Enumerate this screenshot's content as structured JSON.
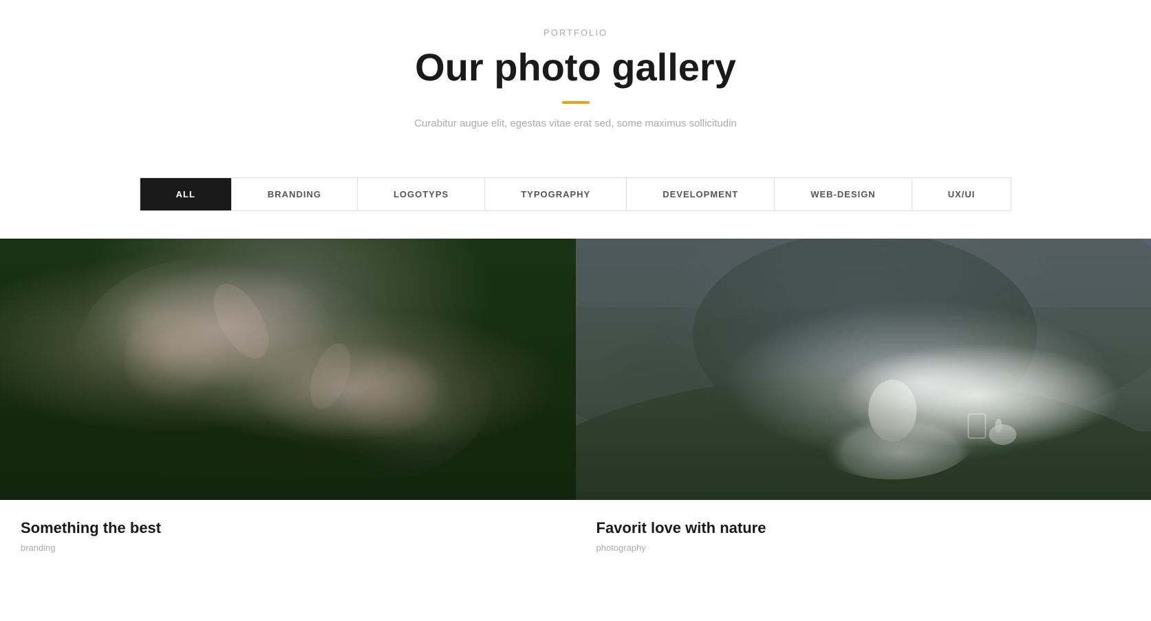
{
  "header": {
    "portfolio_label": "PORTFOLIO",
    "gallery_title": "Our photo gallery",
    "subtitle": "Curabitur augue elit, egestas vitae erat sed, some maximus sollicitudin"
  },
  "filters": {
    "tabs": [
      {
        "id": "all",
        "label": "ALL",
        "active": true
      },
      {
        "id": "branding",
        "label": "BRANDING",
        "active": false
      },
      {
        "id": "logotyps",
        "label": "LOGOTYPS",
        "active": false
      },
      {
        "id": "typography",
        "label": "TYPOGRAPHY",
        "active": false
      },
      {
        "id": "development",
        "label": "DEVELOPMENT",
        "active": false
      },
      {
        "id": "web-design",
        "label": "WEB-DESIGN",
        "active": false
      },
      {
        "id": "ux-ui",
        "label": "UX/UI",
        "active": false
      }
    ]
  },
  "gallery": {
    "items": [
      {
        "id": "item-1",
        "title": "Something the best",
        "category": "branding",
        "position": "left"
      },
      {
        "id": "item-2",
        "title": "Favorit love with nature",
        "category": "photography",
        "position": "right"
      }
    ]
  },
  "divider_color": "#e8a020"
}
